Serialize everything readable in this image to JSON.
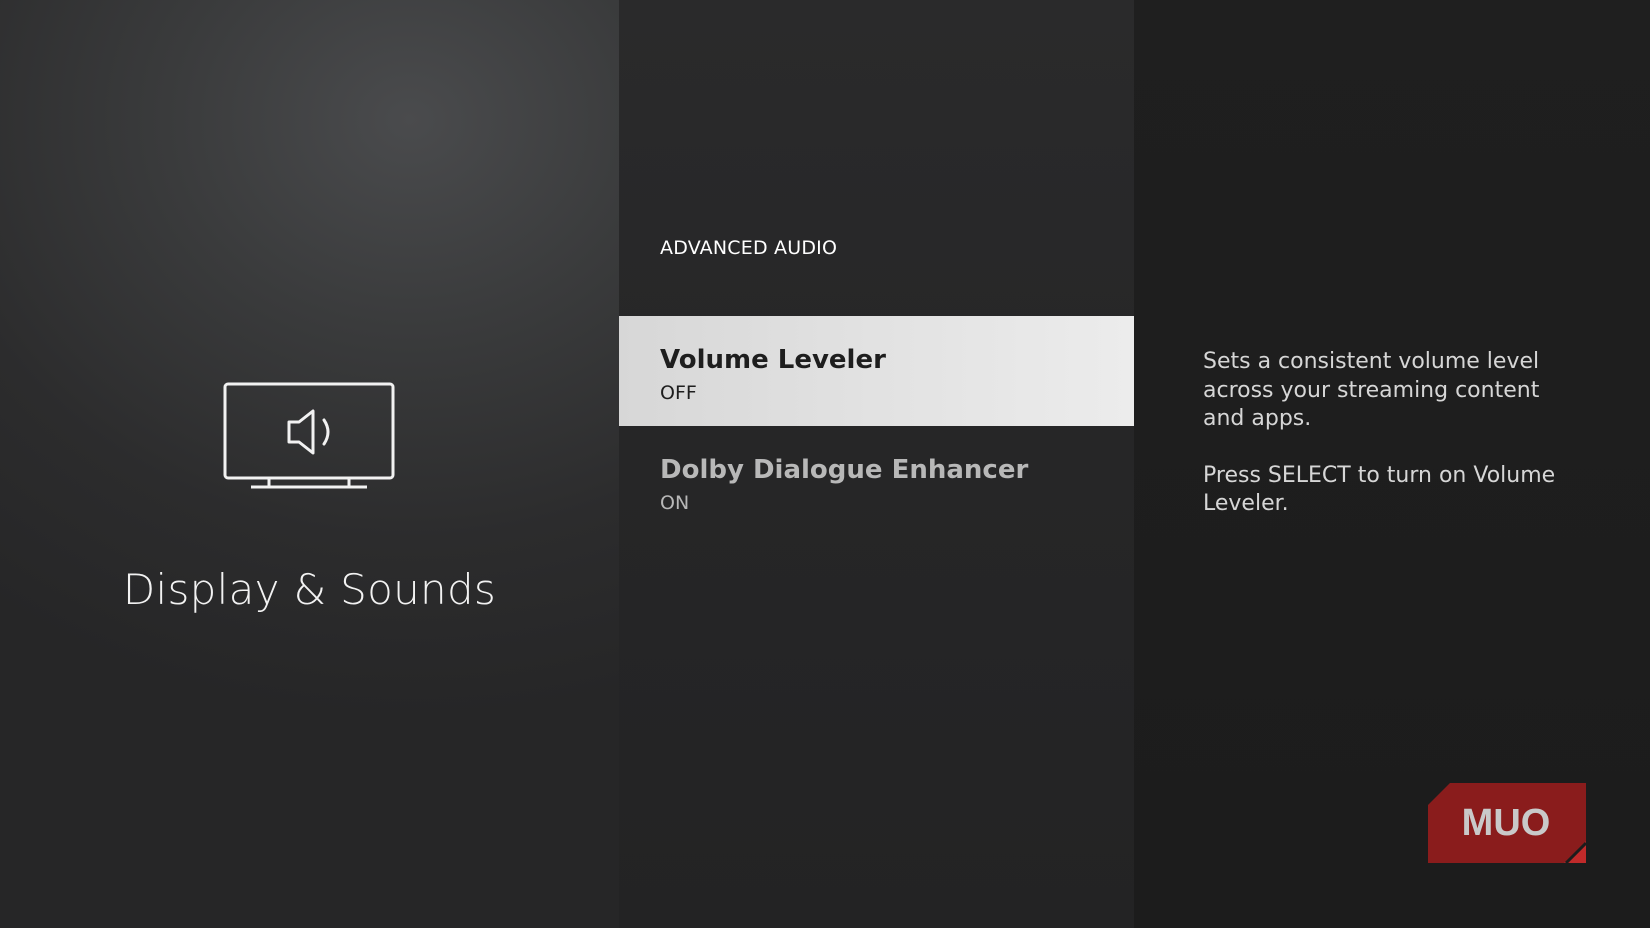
{
  "category": {
    "title": "Display & Sounds",
    "icon": "tv-speaker-icon"
  },
  "section": {
    "header": "ADVANCED AUDIO"
  },
  "menu": {
    "items": [
      {
        "label": "Volume Leveler",
        "value": "OFF",
        "selected": true
      },
      {
        "label": "Dolby Dialogue Enhancer",
        "value": "ON",
        "selected": false
      }
    ]
  },
  "help": {
    "paragraph1": "Sets a consistent volume level across your streaming content and apps.",
    "paragraph2": "Press SELECT to turn on Volume Leveler."
  },
  "watermark": {
    "text": "MUO"
  },
  "colors": {
    "selected_bg": "#e2e2e2",
    "watermark_red": "#8a1c1c",
    "text_primary": "#f2f2f2",
    "text_dim": "#b8b8b8"
  }
}
